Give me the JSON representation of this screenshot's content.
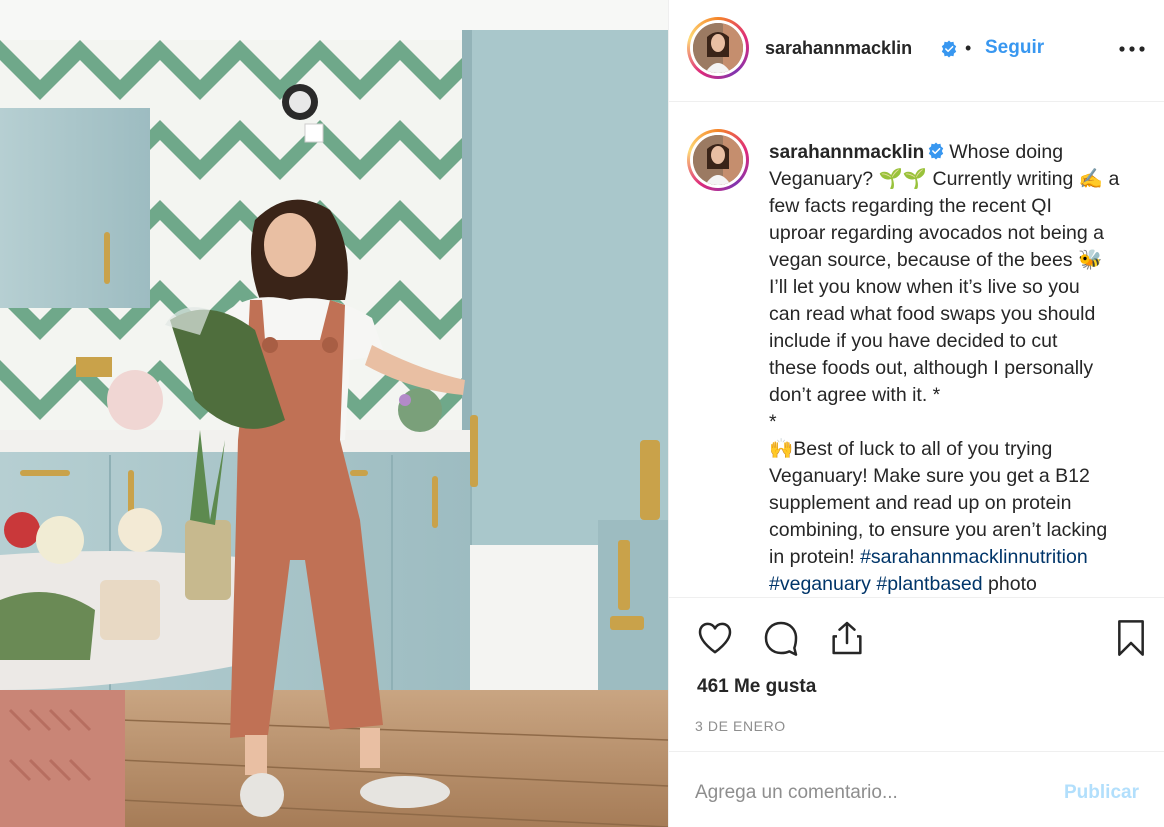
{
  "post": {
    "username": "sarahannmacklin",
    "follow_label": "Seguir",
    "separator": "•"
  },
  "caption": {
    "username": "sarahannmacklin",
    "lines": [
      "Whose doing",
      "Veganuary? 🌱🌱 Currently writing ✍️ a",
      "few facts regarding the recent QI",
      "uproar regarding avocados not being a",
      "vegan source, because of the bees 🐝",
      "I’ll let you know when it’s live so you",
      "can read what food swaps you should",
      "include if you have decided to cut",
      "these foods out, although I personally",
      "don’t agree with it. *",
      "*",
      "🙌Best of luck to all of you trying",
      "Veganuary! Make sure you get a B12",
      "supplement and read up on protein",
      "combining, to ensure you aren’t lacking",
      "in protein!"
    ],
    "hashtag_1": "#sarahannmacklinnutrition",
    "hashtag_2": "#veganuary",
    "hashtag_3": "#plantbased",
    "trailing_word": "photo"
  },
  "engagement": {
    "likes": "461 Me gusta",
    "date": "3 DE ENERO"
  },
  "comment_box": {
    "placeholder": "Agrega un comentario...",
    "publish_label": "Publicar"
  },
  "icons": {
    "verified": "verified-badge-icon",
    "more": "more-options-icon",
    "like": "heart-icon",
    "comment": "comment-icon",
    "share": "share-icon",
    "save": "bookmark-icon"
  },
  "colors": {
    "link_blue": "#3897f0",
    "hashtag": "#003569",
    "muted": "#8e8e8e",
    "publish_disabled": "#b2dffc"
  }
}
